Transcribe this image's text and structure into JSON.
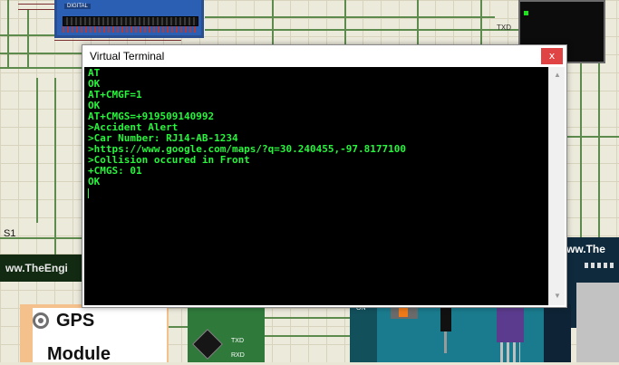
{
  "background": {
    "lcd_label": "DIGITAL",
    "txd_top": "TXD",
    "s1": "S1",
    "site_left": "ww.TheEngi",
    "site_right": "ww.The",
    "gps_title": "GPS",
    "gps_subtitle": "Module",
    "green_board_txd": "TXD",
    "green_board_rxd": "RXD",
    "teal_on": "ON"
  },
  "window": {
    "title": "Virtual Terminal",
    "close_glyph": "x",
    "scroll_up": "▲",
    "scroll_down": "▼"
  },
  "terminal": {
    "lines": [
      "AT",
      "OK",
      "AT+CMGF=1",
      "OK",
      "AT+CMGS=+919509140992",
      ">Accident Alert",
      ">Car Number: RJ14-AB-1234",
      ">https://www.google.com/maps/?q=30.240455,-97.8177100",
      ">Collision occured in Front",
      "+CMGS: 01",
      "OK",
      ""
    ],
    "text_color": "#27f43c",
    "background_color": "#000000"
  }
}
